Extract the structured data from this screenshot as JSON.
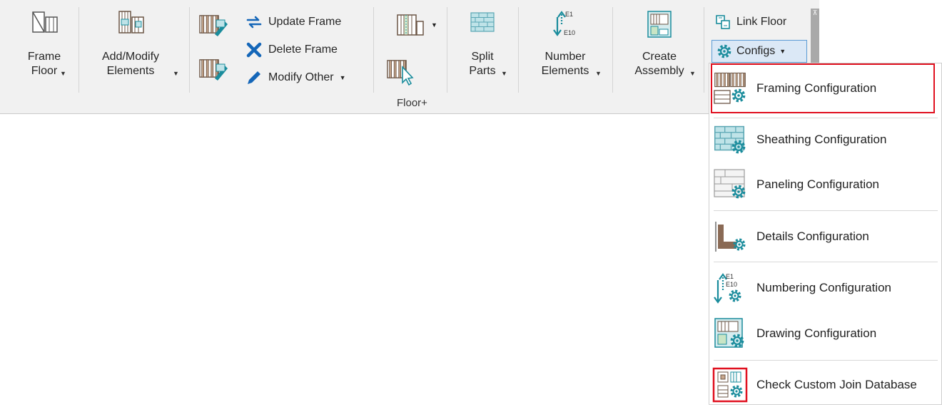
{
  "ribbon": {
    "frame_floor": {
      "line1": "Frame",
      "line2": "Floor"
    },
    "add_modify": {
      "line1": "Add/Modify",
      "line2": "Elements"
    },
    "update_frame": "Update Frame",
    "delete_frame": "Delete Frame",
    "modify_other": "Modify Other",
    "split_parts": {
      "line1": "Split",
      "line2": "Parts"
    },
    "number_elements": {
      "line1": "Number",
      "line2": "Elements"
    },
    "create_assembly": {
      "line1": "Create",
      "line2": "Assembly"
    },
    "link_floor": "Link Floor",
    "configs": "Configs",
    "group_label": "Floor+",
    "number_icon_top": "E1",
    "number_icon_bottom": "E10"
  },
  "menu": {
    "items": [
      {
        "label": "Framing Configuration",
        "icon": "framing-config-icon",
        "highlighted": true
      },
      {
        "label": "Sheathing Configuration",
        "icon": "sheathing-config-icon"
      },
      {
        "label": "Paneling Configuration",
        "icon": "paneling-config-icon"
      },
      {
        "label": "Details Configuration",
        "icon": "details-config-icon"
      },
      {
        "label": "Numbering Configuration",
        "icon": "numbering-config-icon"
      },
      {
        "label": "Drawing Configuration",
        "icon": "drawing-config-icon"
      },
      {
        "label": "Check Custom Join Database",
        "icon": "check-join-db-icon",
        "icon_highlighted": true
      }
    ],
    "numbering_icon_top": "E1",
    "numbering_icon_bottom": "E10"
  },
  "colors": {
    "highlight": "#e0101f",
    "accent": "#1a8c9c",
    "wood": "#8a6a55",
    "ribbon_bg": "#f1f1f1"
  }
}
